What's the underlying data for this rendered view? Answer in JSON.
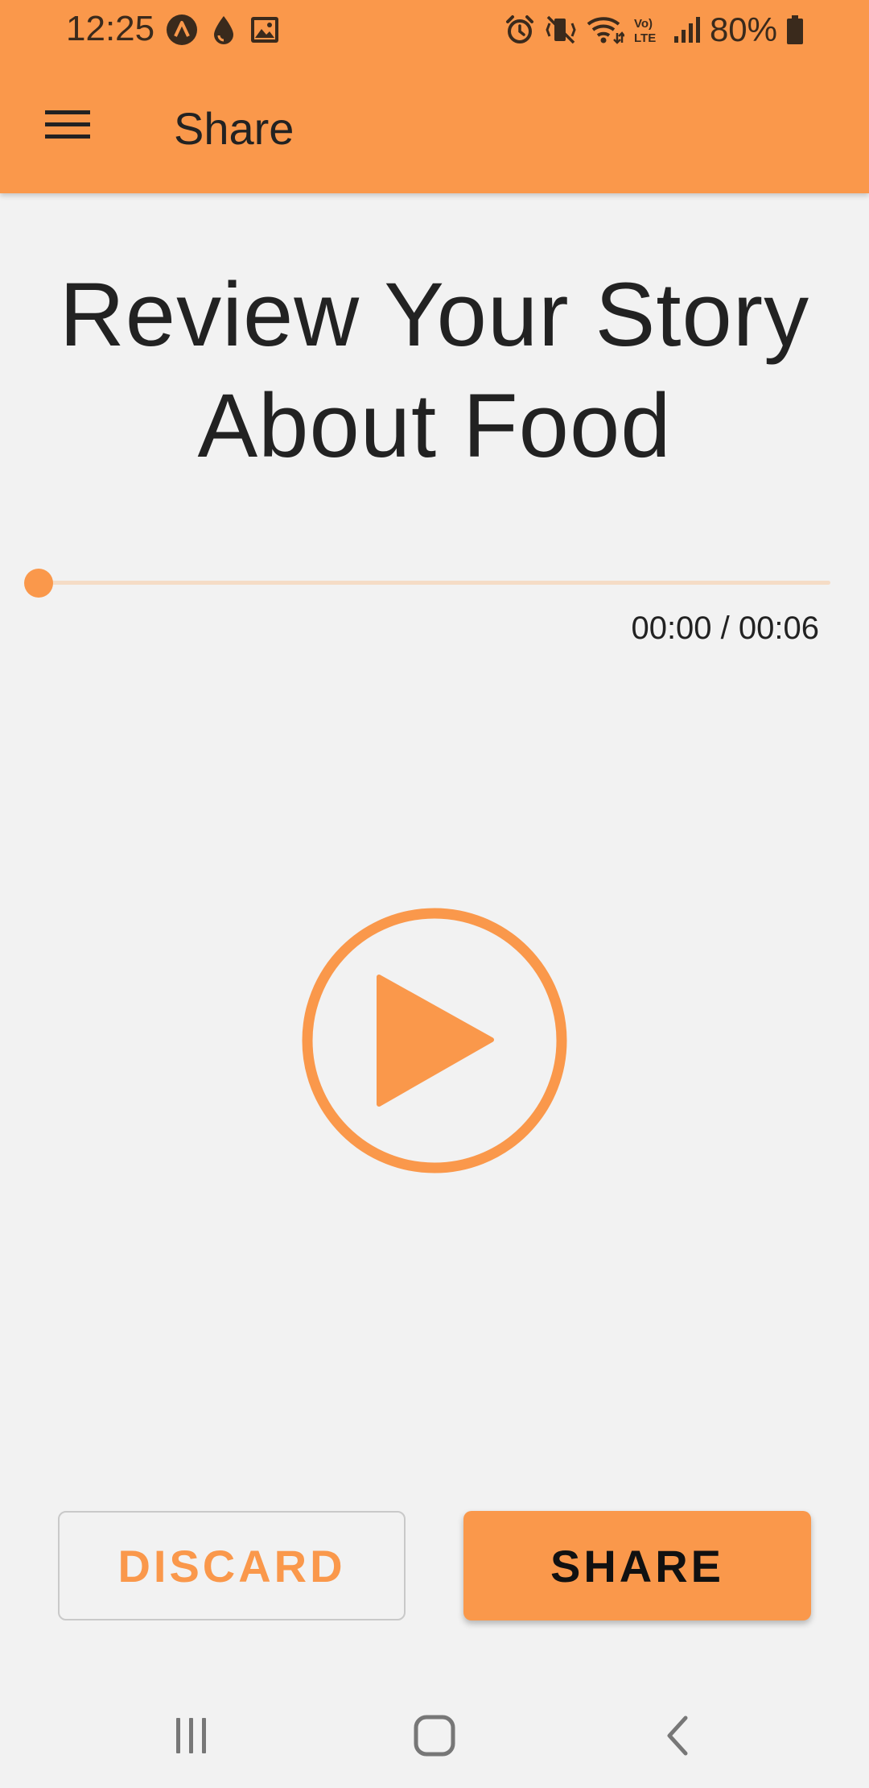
{
  "status_bar": {
    "time": "12:25",
    "battery_percent": "80%",
    "left_icons": [
      "a-badge-icon",
      "droplet-icon",
      "image-icon"
    ],
    "right_icons": [
      "alarm-icon",
      "vibrate-mute-icon",
      "wifi-icon",
      "volte-icon",
      "signal-icon",
      "battery-icon"
    ]
  },
  "app_bar": {
    "title": "Share",
    "menu_icon": "hamburger-menu-icon"
  },
  "story": {
    "title": "Review Your Story About Food"
  },
  "player": {
    "progress": 0,
    "time_display": "00:00 / 00:06",
    "play_icon": "play-circle-icon"
  },
  "actions": {
    "discard_label": "DISCARD",
    "share_label": "SHARE"
  },
  "nav_bar": {
    "icons": [
      "recent-apps-icon",
      "home-icon",
      "back-icon"
    ]
  },
  "colors": {
    "accent": "#fa984b",
    "background": "#f2f2f2",
    "track": "#f5dcc6"
  }
}
